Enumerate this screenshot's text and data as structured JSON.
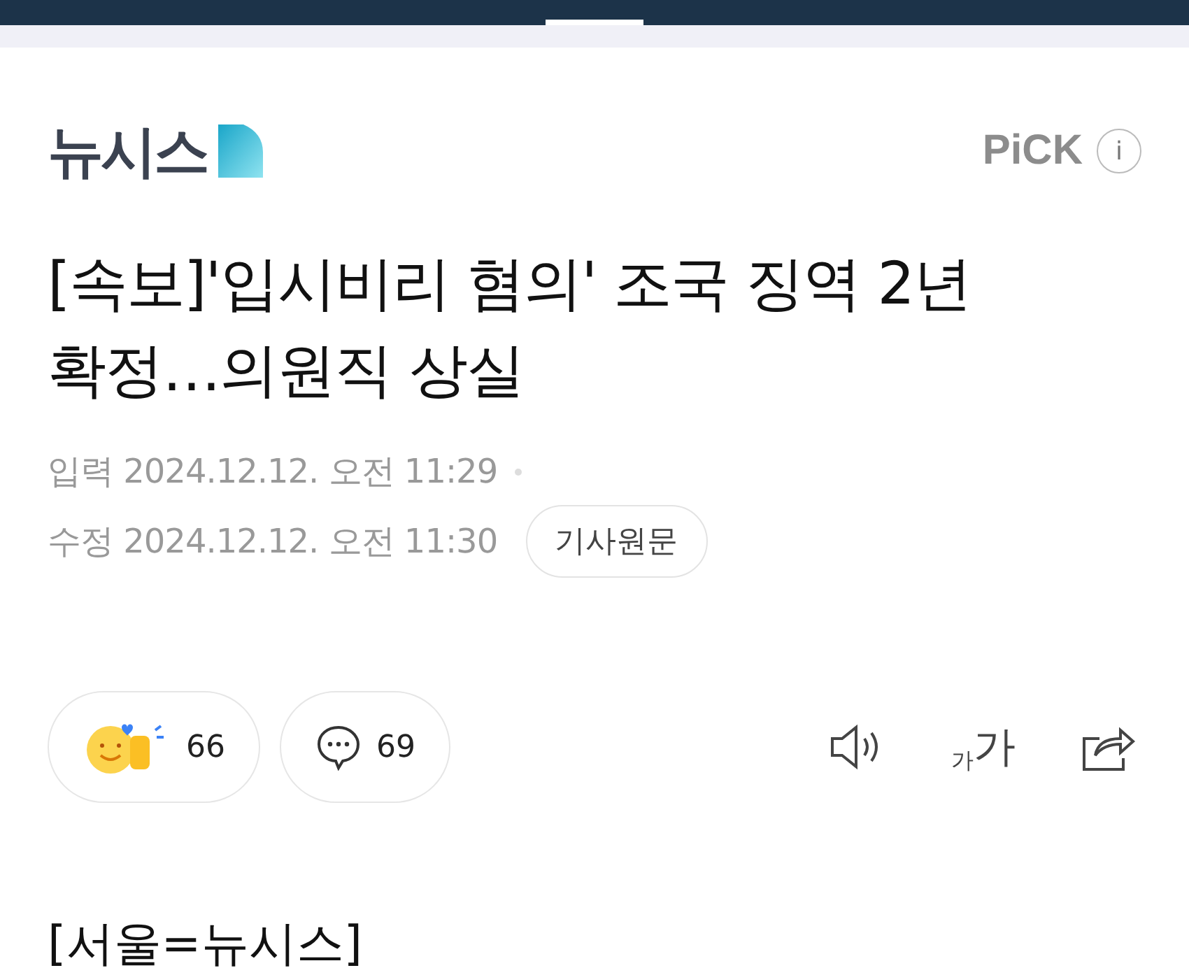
{
  "header": {
    "logo": "뉴시스",
    "pick": "PiCK",
    "info_icon": "i"
  },
  "article": {
    "title": "[속보]'입시비리 혐의' 조국 징역 2년 확정…의원직 상실",
    "dates": [
      {
        "label": "입력",
        "value": "2024.12.12. 오전 11:29"
      },
      {
        "label": "수정",
        "value": "2024.12.12. 오전 11:30"
      }
    ],
    "original_button": "기사원문",
    "reactions": {
      "count": "66"
    },
    "comments": {
      "count": "69"
    },
    "font_size": {
      "small": "가",
      "large": "가"
    },
    "body": "[서울=뉴시스]"
  }
}
